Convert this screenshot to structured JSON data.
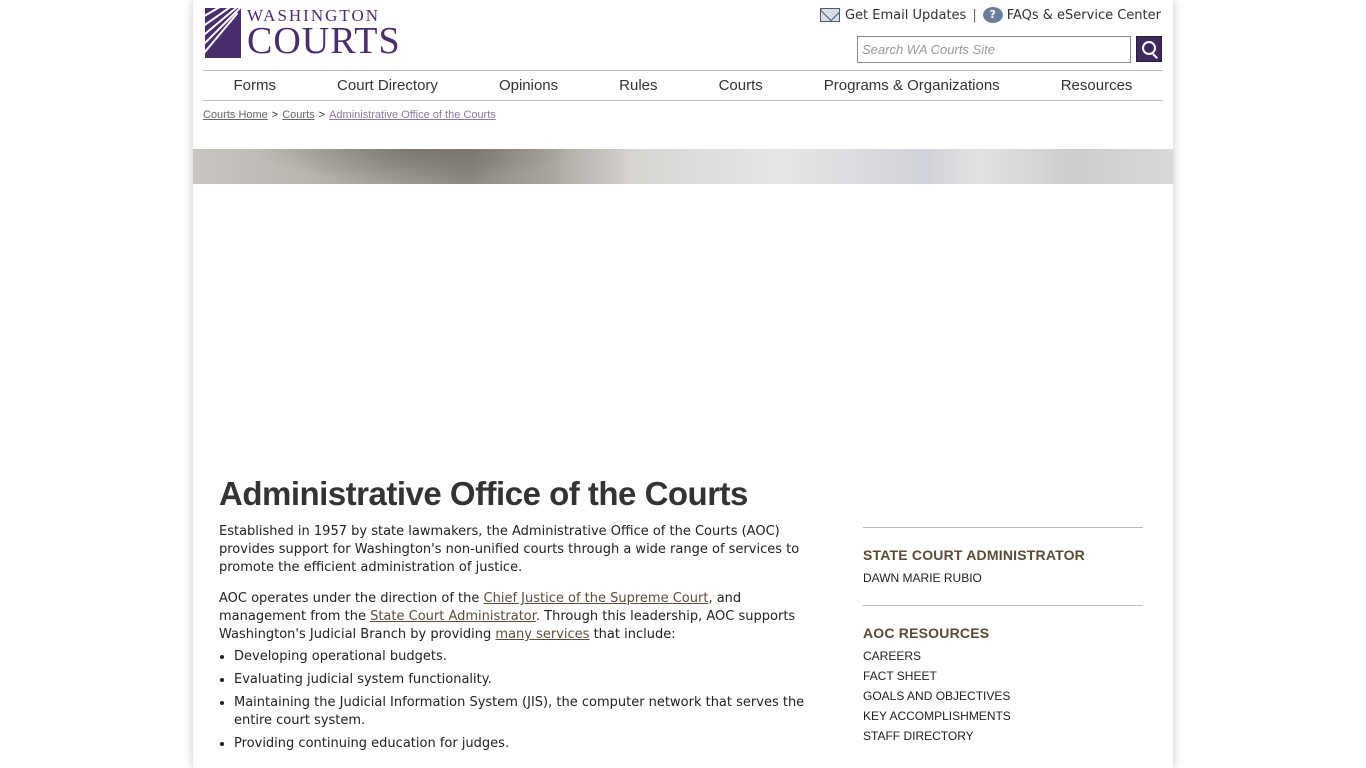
{
  "logo": {
    "top": "WASHINGTON",
    "bottom": "COURTS"
  },
  "utility": {
    "email_label": "Get Email Updates",
    "separator": "|",
    "faq_label": "FAQs & eService Center",
    "email_icon": "mail-icon",
    "help_icon": "question-icon"
  },
  "search": {
    "placeholder": "Search WA Courts Site",
    "button_icon": "search-icon"
  },
  "nav": {
    "items": [
      "Forms",
      "Court Directory",
      "Opinions",
      "Rules",
      "Courts",
      "Programs & Organizations",
      "Resources"
    ]
  },
  "breadcrumb": {
    "items": [
      "Courts Home",
      "Courts",
      "Administrative Office of the Courts"
    ],
    "separator": ">"
  },
  "main": {
    "title": "Administrative Office of the Courts",
    "intro": "Established in 1957 by state lawmakers, the Administrative Office of the Courts (AOC) provides support for Washington's non-unified courts through a wide range of services to promote the efficient administration of justice.",
    "p2_part1": "AOC operates under the direction of the ",
    "p2_link1": "Chief Justice of the Supreme Court",
    "p2_part2": ", and management from the ",
    "p2_link2": "State Court Administrator",
    "p2_part3": ". Through this leadership, AOC supports Washington's Judicial Branch by providing ",
    "p2_link3": "many services",
    "p2_part4": " that include:",
    "bullets": [
      "Developing operational budgets.",
      "Evaluating judicial system functionality.",
      "Maintaining the Judicial Information System (JIS), the computer network that serves the entire court system.",
      "Providing continuing education for judges."
    ]
  },
  "sidebar": {
    "administrator_heading": "STATE COURT ADMINISTRATOR",
    "administrator_name": "DAWN MARIE RUBIO",
    "resources_heading": "AOC RESOURCES",
    "resources": [
      "CAREERS",
      "FACT SHEET",
      "GOALS AND OBJECTIVES",
      "KEY ACCOMPLISHMENTS",
      "STAFF DIRECTORY"
    ]
  },
  "colors": {
    "brand_purple": "#4a2d6b",
    "heading_brown": "#5a4a36"
  }
}
